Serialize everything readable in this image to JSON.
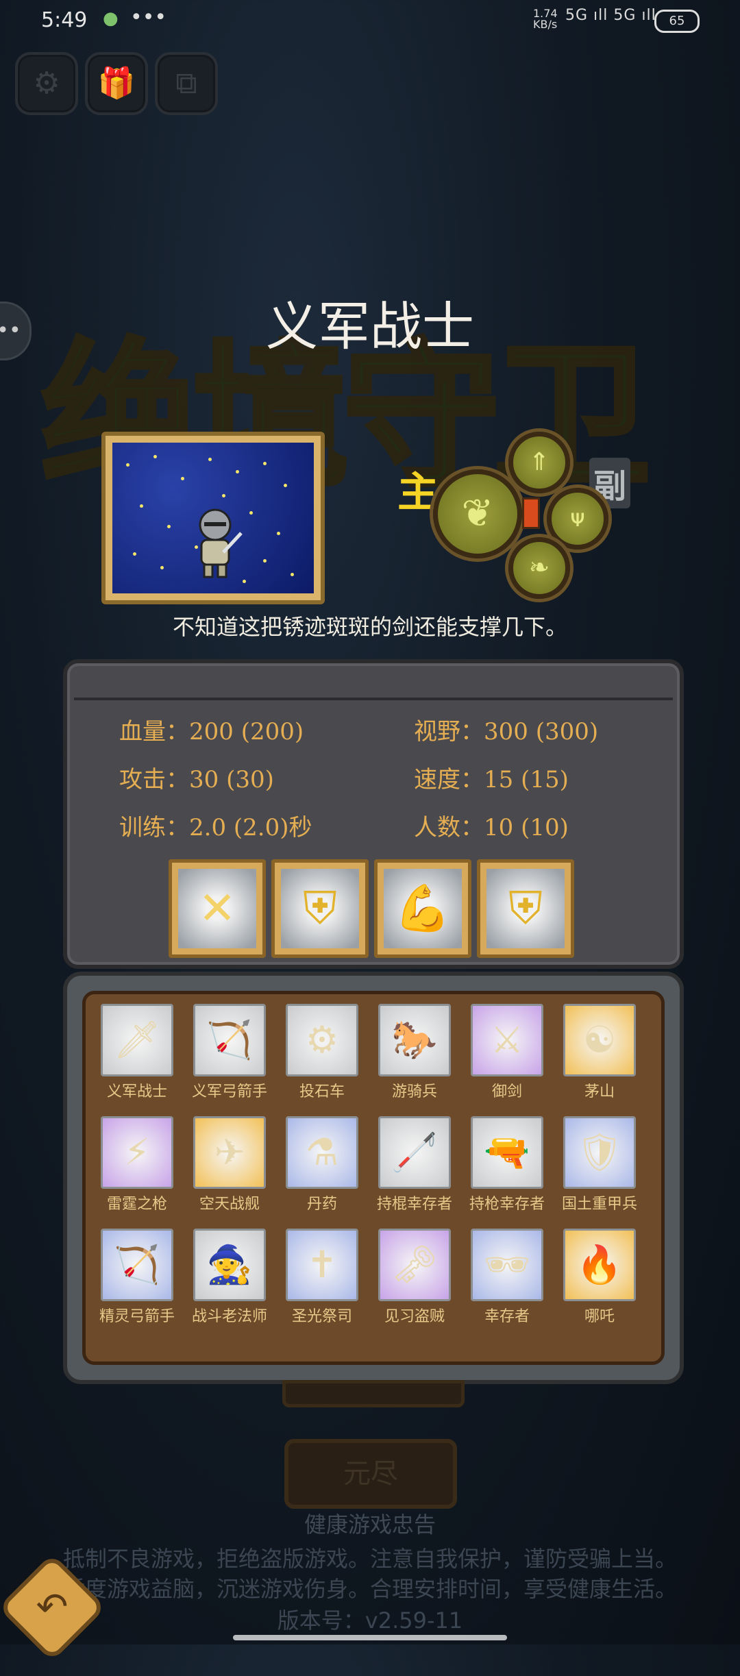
{
  "status_bar": {
    "time": "5:49",
    "app_icon": "wechat-icon",
    "dots": "•••",
    "net_speed_top": "1.74",
    "net_speed_bottom": "KB/s",
    "signal": "5G ıll 5G ıll",
    "battery": "65"
  },
  "top_buttons": [
    {
      "icon": "gear-icon",
      "glyph": "⚙"
    },
    {
      "icon": "gift-icon",
      "glyph": "🎁"
    },
    {
      "icon": "copy-icon",
      "glyph": "⧉"
    }
  ],
  "background_title": "绝境守卫",
  "unit": {
    "name": "义军战士",
    "description": "不知道这把锈迹斑斑的剑还能支撑几下。",
    "stats": {
      "hp": "血量：200 (200)",
      "vision": "视野：300 (300)",
      "attack": "攻击：30 (30)",
      "speed": "速度：15 (15)",
      "training": "训练：2.0 (2.0)秒",
      "count": "人数：10 (10)"
    }
  },
  "talent": {
    "main_label": "主",
    "sub_label": "副"
  },
  "skills": [
    {
      "icon": "crossed-swords-icon",
      "glyph": "✕"
    },
    {
      "icon": "shield-icon",
      "glyph": "⛨"
    },
    {
      "icon": "strength-arm-icon",
      "glyph": "💪"
    },
    {
      "icon": "shield-sparkle-icon",
      "glyph": "⛨"
    }
  ],
  "units": [
    {
      "name": "义军战士",
      "glyph": "🗡",
      "bg": "#c9cbcd"
    },
    {
      "name": "义军弓箭手",
      "glyph": "🏹",
      "bg": "#c9cbcd"
    },
    {
      "name": "投石车",
      "glyph": "⚙",
      "bg": "#c9cbcd"
    },
    {
      "name": "游骑兵",
      "glyph": "🐎",
      "bg": "#c9cbcd"
    },
    {
      "name": "御剑",
      "glyph": "⚔",
      "bg": "#c7a3e8"
    },
    {
      "name": "茅山",
      "glyph": "☯",
      "bg": "#f2c056"
    },
    {
      "name": "雷霆之枪",
      "glyph": "⚡",
      "bg": "#c7a3e8"
    },
    {
      "name": "空天战舰",
      "glyph": "✈",
      "bg": "#f2c056"
    },
    {
      "name": "丹药",
      "glyph": "⚗",
      "bg": "#aab8e8"
    },
    {
      "name": "持棍幸存者",
      "glyph": "🦯",
      "bg": "#c9cbcd"
    },
    {
      "name": "持枪幸存者",
      "glyph": "🔫",
      "bg": "#c9cbcd"
    },
    {
      "name": "国土重甲兵",
      "glyph": "🛡",
      "bg": "#aab8e8"
    },
    {
      "name": "精灵弓箭手",
      "glyph": "🏹",
      "bg": "#aab8e8"
    },
    {
      "name": "战斗老法师",
      "glyph": "🧙",
      "bg": "#c9cbcd"
    },
    {
      "name": "圣光祭司",
      "glyph": "✝",
      "bg": "#aab8e8"
    },
    {
      "name": "见习盗贼",
      "glyph": "🗝",
      "bg": "#c7a3e8"
    },
    {
      "name": "幸存者",
      "glyph": "🕶",
      "bg": "#aab8e8"
    },
    {
      "name": "哪吒",
      "glyph": "🔥",
      "bg": "#f2c056"
    }
  ],
  "bottom": {
    "button_label": "元尽",
    "notice_title": "健康游戏忠告",
    "notice_line1": "抵制不良游戏，拒绝盗版游戏。注意自我保护，谨防受骗上当。",
    "notice_line2": "适度游戏益脑，沉迷游戏伤身。合理安排时间，享受健康生活。",
    "version": "版本号：v2.59-11"
  }
}
